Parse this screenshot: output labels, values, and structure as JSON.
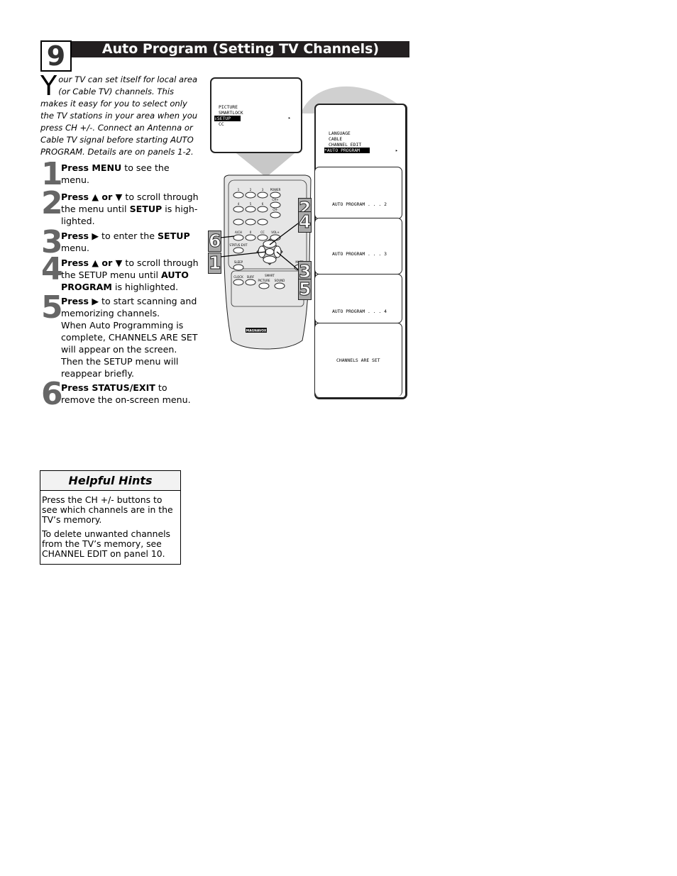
{
  "panel": {
    "number": "9",
    "title": "Auto Program (Setting TV Channels)"
  },
  "intro": {
    "dropcap": "Y",
    "text": "our TV can set itself for local area (or Cable TV) channels. This makes it easy for you to select only the TV stations in your area when you press CH +/-. Connect an Antenna or Cable TV signal before starting AUTO PROGRAM. Details are on panels 1-2."
  },
  "steps": [
    {
      "n": "1",
      "bold": "Press MENU",
      "text": " to see the menu."
    },
    {
      "n": "2",
      "bold": "Press ▲ or ▼",
      "text": " to scroll through the menu until ",
      "bold2": "SETUP",
      "text2": " is high-lighted."
    },
    {
      "n": "3",
      "bold": "Press ▶",
      "text": " to enter the ",
      "bold2": "SETUP",
      "text2": " menu."
    },
    {
      "n": "4",
      "bold": "Press ▲ or ▼",
      "text": " to scroll through the SETUP menu until ",
      "bold2": "AUTO PROGRAM",
      "text2": " is highlighted."
    },
    {
      "n": "5",
      "bold": "Press ▶",
      "text": " to start scanning and memorizing channels.",
      "text2": "When Auto Programming is complete, CHANNELS ARE SET will appear on the screen. Then the SETUP menu will reappear briefly."
    },
    {
      "n": "6",
      "bold": "Press STATUS/EXIT",
      "text": " to remove the on-screen menu."
    }
  ],
  "hints": {
    "title": "Helpful Hints",
    "items": [
      "Press the CH +/- buttons to see which channels are in the TV’s memory.",
      "To delete unwanted channels from the TV’s memory, see CHANNEL EDIT on panel 10."
    ]
  },
  "main_menu": {
    "items": [
      "PICTURE",
      "SMARTLOCK",
      "SETUP",
      "CC"
    ],
    "selected": "SETUP",
    "marker": "⇕",
    "arrow": "▸"
  },
  "setup_menu": {
    "items": [
      "LANGUAGE",
      "CABLE",
      "CHANNEL EDIT",
      "AUTO PROGRAM"
    ],
    "selected": "AUTO PROGRAM",
    "marker": "*",
    "arrow": "▸"
  },
  "progress_screens": [
    "AUTO PROGRAM . . . 2",
    "AUTO PROGRAM . . . 3",
    "AUTO PROGRAM . . . 4",
    "CHANNELS ARE SET"
  ],
  "remote": {
    "buttons": [
      "1",
      "2",
      "3",
      "POWER",
      "4",
      "5",
      "6",
      "CH+",
      "CH-",
      "A/CH",
      "0",
      "CC",
      "VOL+",
      "STATUS EXIT",
      "MENU",
      "SLEEP",
      "MUTE",
      "CLOCK",
      "SURF",
      "SMART",
      "PICTURE",
      "SOUND"
    ],
    "brand": "MAGNAVOX",
    "callouts": [
      "2",
      "4",
      "6",
      "1",
      "3",
      "5"
    ]
  }
}
